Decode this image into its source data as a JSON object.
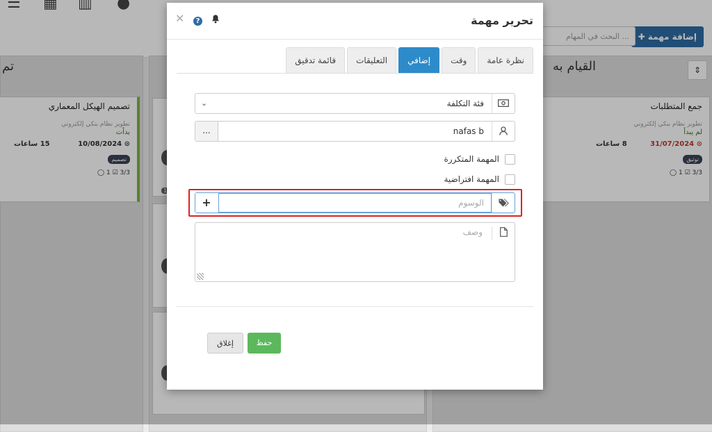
{
  "app": {
    "add_task_label": "إضافة مهمة",
    "search_placeholder": "البحث في المهام ..."
  },
  "board": {
    "col_right_title": "القيام به",
    "col_left_title": "تم",
    "card_right": {
      "title": "جمع المتطلبات",
      "project": "تطوير نظام بنكي إلكتروني",
      "status": "لم يبدأ",
      "date": "31/07/2024",
      "hours": "8 ساعات",
      "tag": "توثيق",
      "checks": "3/3",
      "comments": "1"
    },
    "card_left": {
      "title": "تصميم الهيكل المعماري",
      "project": "تطوير نظام بنكي إلكتروني",
      "status": "بدأت",
      "date": "10/08/2024",
      "hours": "15 ساعات",
      "tag": "تصميم",
      "checks": "3/3",
      "comments": "1"
    },
    "mid_badge": "1"
  },
  "modal": {
    "title": "تحرير مهمة",
    "tabs": [
      "نظرة عامة",
      "وقت",
      "إضافي",
      "التعليقات",
      "قائمة تدقيق"
    ],
    "active_tab": "إضافي",
    "cost_category": "فئة التكلفة",
    "assignee": "nafas b",
    "more_label": "...",
    "recurring_label": "المهمة المتكررة",
    "default_label": "المهمة افتراضية",
    "tags_placeholder": "الوسوم",
    "add_tag_label": "+",
    "description_placeholder": "وصف",
    "save_label": "حفظ",
    "close_label": "إغلاق"
  },
  "colors": {
    "primary": "#2e6da4",
    "tab_active": "#2e8bc9",
    "save": "#5cb85c",
    "highlight": "#dd2222",
    "card_accent": "#7cb342"
  },
  "icons": [
    "close-icon",
    "help-icon",
    "bell-icon",
    "money-icon",
    "user-icon",
    "tag-icon",
    "file-icon",
    "plus-icon",
    "chevron-down-icon",
    "sort-icon"
  ]
}
